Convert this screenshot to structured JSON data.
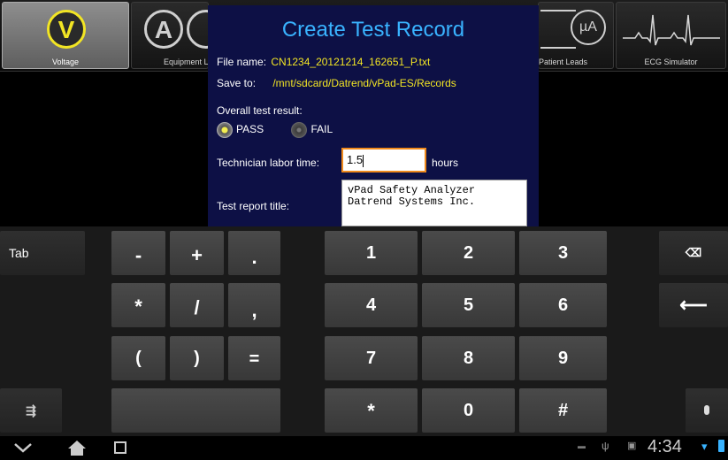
{
  "toolbar": {
    "items": [
      {
        "label": "Voltage",
        "icon": "V"
      },
      {
        "label": "Equipment Leakage",
        "icon": "A"
      },
      {
        "label": "Patient Leads",
        "icon": "µA"
      },
      {
        "label": "ECG Simulator",
        "icon": "ecg-waveform"
      }
    ]
  },
  "dialog": {
    "title": "Create Test Record",
    "file_name_label": "File name:",
    "file_name_value": "CN1234_20121214_162651_P.txt",
    "save_to_label": "Save to:",
    "save_to_value": "/mnt/sdcard/Datrend/vPad-ES/Records",
    "overall_label": "Overall test result:",
    "pass_label": "PASS",
    "fail_label": "FAIL",
    "selected_result": "PASS",
    "labor_label": "Technician labor time:",
    "labor_value": "1.5",
    "hours_label": "hours",
    "report_title_label": "Test report title:",
    "report_title_lines": [
      "vPad Safety Analyzer",
      "Datrend Systems Inc."
    ]
  },
  "keyboard": {
    "tab": "Tab",
    "row1": [
      "-",
      "+",
      ".",
      "1",
      "2",
      "3"
    ],
    "row2": [
      "*",
      "/",
      ",",
      "4",
      "5",
      "6"
    ],
    "row3": [
      "(",
      ")",
      "=",
      "7",
      "8",
      "9"
    ],
    "row4": [
      "*",
      "0",
      "#"
    ]
  },
  "statusbar": {
    "time": "4:34"
  },
  "colors": {
    "accent": "#39b3ff",
    "dialog_bg": "#0d1045",
    "highlight_text": "#f2e524",
    "focus_border": "#f08a1c"
  }
}
